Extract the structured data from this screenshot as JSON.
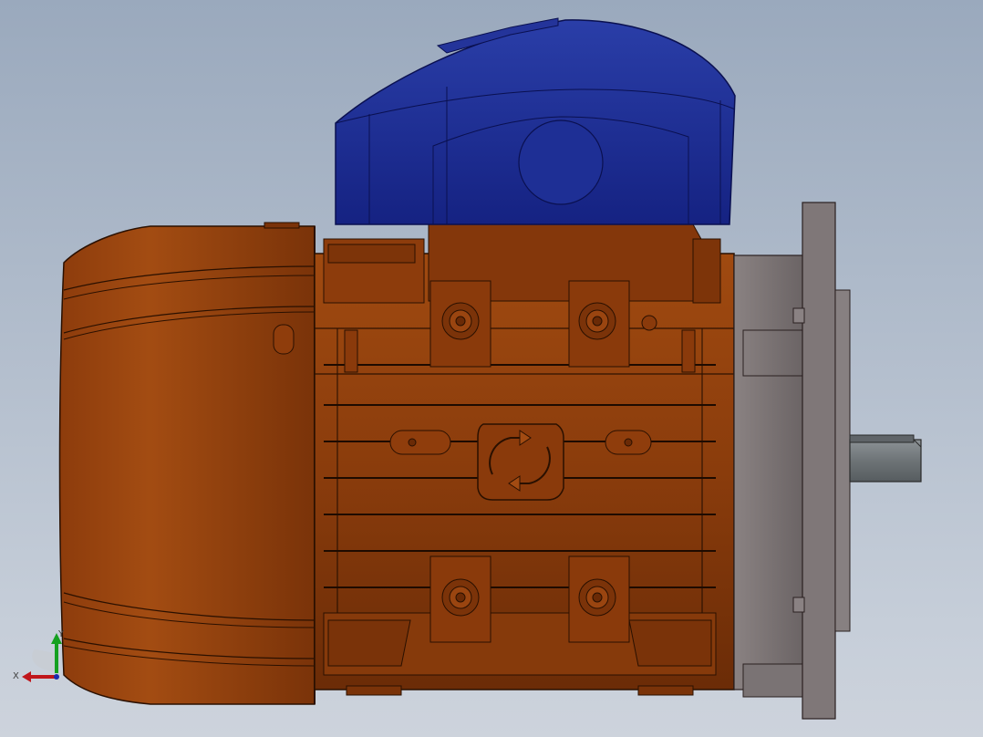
{
  "window": {
    "view": "Front",
    "model_colors": {
      "housing": "#8a3c0c",
      "housing_dark": "#5a2404",
      "fan_cover": "#1b2a8c",
      "flange": "#7b7576",
      "shaft": "#6e7477",
      "background_top": "#9aa9bd",
      "background_bottom": "#cdd3dc"
    }
  },
  "triad": {
    "x_label": "X",
    "y_label": "Y",
    "x_color": "#c0161b",
    "y_color": "#15a020"
  }
}
